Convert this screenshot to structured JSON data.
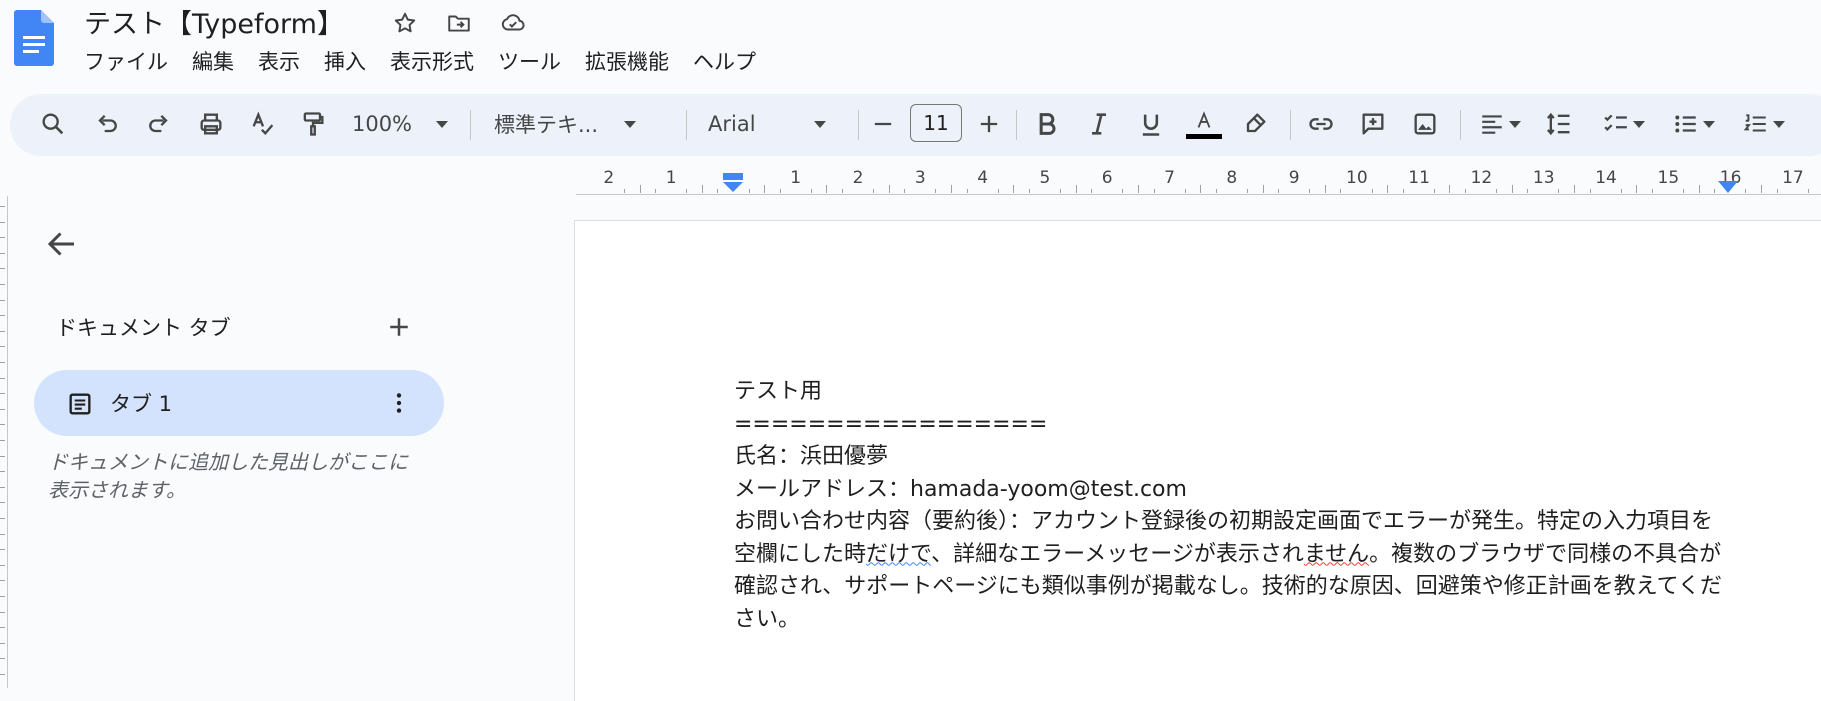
{
  "app": {
    "title": "テスト【Typeform】",
    "colors": {
      "accent": "#1a73e8",
      "toolbar_bg": "#edf2fa",
      "selected_tab": "#d3e3fd"
    }
  },
  "menu": [
    "ファイル",
    "編集",
    "表示",
    "挿入",
    "表示形式",
    "ツール",
    "拡張機能",
    "ヘルプ"
  ],
  "toolbar": {
    "zoom": "100%",
    "style": "標準テキ...",
    "font": "Arial",
    "font_size": "11",
    "icons": [
      "search-icon",
      "undo-icon",
      "redo-icon",
      "print-icon",
      "spellcheck-icon",
      "paint-format-icon",
      "bold-icon",
      "italic-icon",
      "underline-icon",
      "text-color-icon",
      "highlight-icon",
      "link-icon",
      "add-comment-icon",
      "insert-image-icon",
      "align-icon",
      "line-spacing-icon",
      "checklist-icon",
      "bulleted-list-icon",
      "numbered-list-icon"
    ]
  },
  "ruler": {
    "numbers": [
      "2",
      "1",
      "1",
      "2",
      "3",
      "4",
      "5",
      "6",
      "7",
      "8",
      "9",
      "10",
      "11",
      "12",
      "13",
      "14",
      "15",
      "16",
      "17"
    ]
  },
  "sidebar": {
    "heading": "ドキュメント タブ",
    "tab_label": "タブ 1",
    "outline_hint": "ドキュメントに追加した見出しがここに表示されます。"
  },
  "document": {
    "line1": "テスト用",
    "line2": "=================",
    "line3": "氏名：浜田優夢",
    "line4": "メールアドレス：hamada-yoom@test.com",
    "para_a": "お問い合わせ内容（要約後）：アカウント登録後の初期設定画面でエラーが発生。特定の入力項目を空欄にした時",
    "para_sq1": "だけで",
    "para_b": "、詳細なエラーメッセージが表示され",
    "para_sq2": "ません",
    "para_c": "。複数のブラウザで同様の不具合が確認され、サポートページにも類似事例が掲載なし。技術的な原因、回避策や修正計画を教えてください。"
  }
}
